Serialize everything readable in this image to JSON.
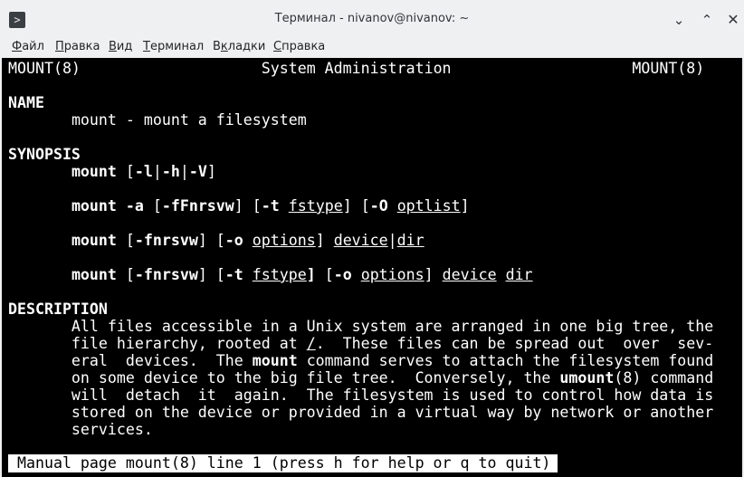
{
  "window": {
    "title": "Терминал - nivanov@nivanov: ~",
    "app_icon_glyph": ">",
    "minimize_glyph": "⌄",
    "maximize_glyph": "⌃",
    "close_glyph": "✕"
  },
  "menu": [
    {
      "pre": "",
      "acc": "Ф",
      "post": "айл"
    },
    {
      "pre": "",
      "acc": "П",
      "post": "равка"
    },
    {
      "pre": "",
      "acc": "В",
      "post": "ид"
    },
    {
      "pre": "",
      "acc": "Т",
      "post": "ерминал"
    },
    {
      "pre": "В",
      "acc": "к",
      "post": "ладки"
    },
    {
      "pre": "",
      "acc": "С",
      "post": "правка"
    }
  ],
  "man": {
    "header_left": "MOUNT(8)",
    "header_center": "System Administration",
    "header_right": "MOUNT(8)",
    "name_heading": "NAME",
    "name_text": "mount - mount a filesystem",
    "synopsis_heading": "SYNOPSIS",
    "description_heading": "DESCRIPTION",
    "status_line": "Manual page mount(8) line 1 (press h for help or q to quit)"
  }
}
